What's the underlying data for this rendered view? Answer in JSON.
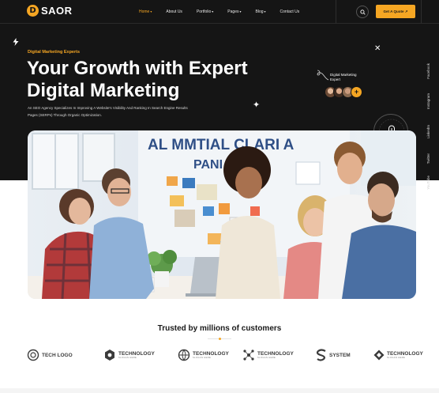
{
  "brand": {
    "name": "SAOR",
    "mark": "D"
  },
  "nav": [
    {
      "label": "Home",
      "caret": "▾",
      "active": true
    },
    {
      "label": "About Us",
      "caret": "",
      "active": false
    },
    {
      "label": "Portfolio",
      "caret": "▾",
      "active": false
    },
    {
      "label": "Pages",
      "caret": "▾",
      "active": false
    },
    {
      "label": "Blog",
      "caret": "▾",
      "active": false
    },
    {
      "label": "Contact Us",
      "caret": "",
      "active": false
    }
  ],
  "header": {
    "quote_button": "Get A Quote ↗",
    "search_icon": "search-icon"
  },
  "hero": {
    "kicker": "Digital Marketing Experts",
    "title_line1": "Your Growth with Expert",
    "title_line2": "Digital Marketing",
    "description": "An SEO Agency Specializes In Improving A Website's Visibility And Ranking In Search Engine Results Pages (SERPs) Through Organic Optimization.",
    "badge_label": "Digital Marketing Expert",
    "close_icon": "close-icon",
    "avatar_plus": "+"
  },
  "social": [
    "Facebook",
    "Instagram",
    "LinkedIn",
    "Twitter",
    "YouTube"
  ],
  "photo": {
    "board_text_line1": "AL MMTIAL CLARI A",
    "board_text_line2": "PANI"
  },
  "trusted": {
    "title": "Trusted by millions of customers",
    "brands": [
      {
        "name": "TECH LOGO",
        "sub": "",
        "icon": "tech-logo-icon"
      },
      {
        "name": "TECHNOLOGY",
        "sub": "SLOGAN HERE",
        "icon": "tech-hex-icon"
      },
      {
        "name": "TECHNOLOGY",
        "sub": "SLOGAN HERE",
        "icon": "tech-globe-icon"
      },
      {
        "name": "TECHNOLOGY",
        "sub": "SLOGAN HERE",
        "icon": "tech-network-icon"
      },
      {
        "name": "SYSTEM",
        "sub": "",
        "icon": "system-s-icon"
      },
      {
        "name": "TECHNOLOGY",
        "sub": "SLOGAN HERE",
        "icon": "tech-diamond-icon"
      }
    ]
  },
  "colors": {
    "accent": "#f5a623",
    "dark": "#151515",
    "text_light": "#ffffff"
  }
}
